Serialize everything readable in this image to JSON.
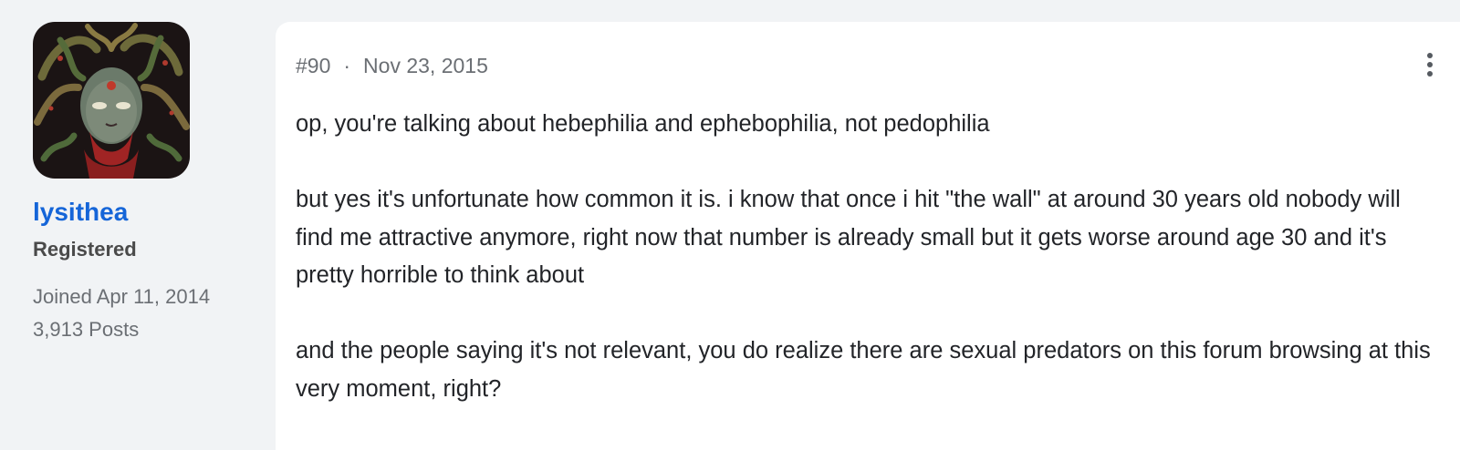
{
  "author": {
    "username": "lysithea",
    "role": "Registered",
    "joined": "Joined Apr 11, 2014",
    "posts": "3,913 Posts",
    "avatar_icon": "medusa-avatar"
  },
  "post": {
    "number": "#90",
    "separator": "·",
    "date": "Nov 23, 2015",
    "more_icon": "more-vertical-icon",
    "paragraphs": [
      "op, you're talking about hebephilia and ephebophilia, not pedophilia",
      "but yes it's unfortunate how common it is. i know that once i hit \"the wall\" at around 30 years old nobody will find me attractive anymore, right now that number is already small but it gets worse around age 30 and it's pretty horrible to think about",
      "and the people saying it's not relevant, you do realize there are sexual predators on this forum browsing at this very moment, right?"
    ]
  },
  "colors": {
    "username": "#1565d8",
    "background": "#f1f3f5",
    "card": "#ffffff"
  }
}
